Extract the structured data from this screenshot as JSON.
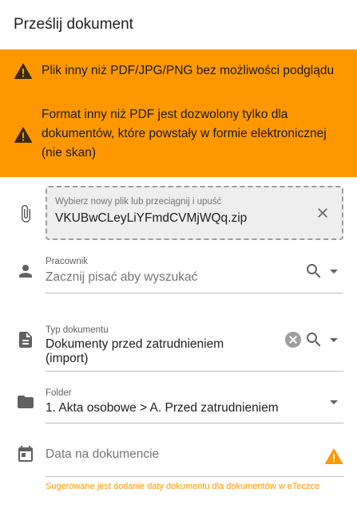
{
  "dialog": {
    "title": "Prześlij dokument"
  },
  "warnings": [
    {
      "text": "Plik inny niż PDF/JPG/PNG bez możliwości podglądu"
    },
    {
      "text": "Format inny niż PDF jest dozwolony tylko dla dokumentów, które powstały w formie elektronicznej (nie skan)"
    }
  ],
  "file": {
    "hint": "Wybierz nowy plik lub przeciągnij i upuść",
    "filename": "VKUBwCLeyLiYFmdCVMjWQq.zip"
  },
  "employee": {
    "label": "Pracownik",
    "placeholder": "Zacznij pisać aby wyszukać"
  },
  "doc_type": {
    "label": "Typ dokumentu",
    "value": "Dokumenty przed zatrudnieniem (import)"
  },
  "folder": {
    "label": "Folder",
    "value": "1. Akta osobowe > A. Przed zatrudnieniem"
  },
  "doc_date": {
    "placeholder": "Data na dokumencie",
    "hint": "Sugerowane jest dodanie daty dokumentu dla dokumentów w eTeczce"
  },
  "colors": {
    "warning": "#ff9800",
    "icon": "#616161"
  }
}
